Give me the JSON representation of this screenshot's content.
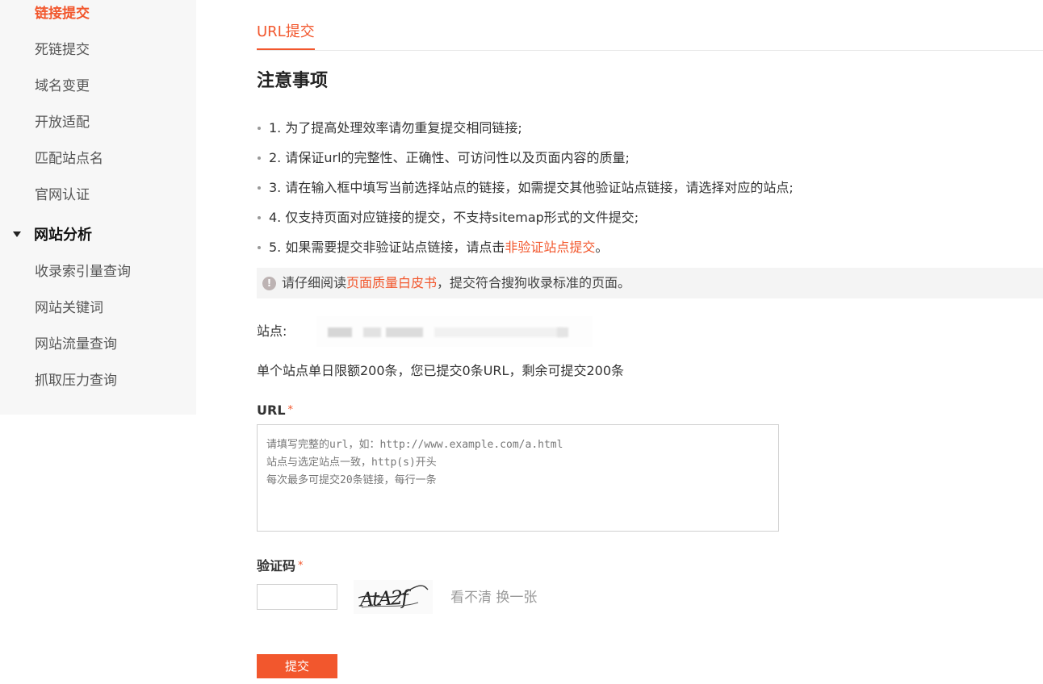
{
  "sidebar": {
    "items_top": [
      {
        "label": "链接提交",
        "active": true
      },
      {
        "label": "死链提交",
        "active": false
      },
      {
        "label": "域名变更",
        "active": false
      },
      {
        "label": "开放适配",
        "active": false
      },
      {
        "label": "匹配站点名",
        "active": false
      },
      {
        "label": "官网认证",
        "active": false
      }
    ],
    "group_label": "网站分析",
    "group_items": [
      {
        "label": "收录索引量查询"
      },
      {
        "label": "网站关键词"
      },
      {
        "label": "网站流量查询"
      },
      {
        "label": "抓取压力查询"
      }
    ]
  },
  "tabs": [
    {
      "label": "URL提交",
      "active": true
    }
  ],
  "notice": {
    "title": "注意事项",
    "items": [
      "1. 为了提高处理效率请勿重复提交相同链接;",
      "2. 请保证url的完整性、正确性、可访问性以及页面内容的质量;",
      "3. 请在输入框中填写当前选择站点的链接，如需提交其他验证站点链接，请选择对应的站点;",
      "4. 仅支持页面对应链接的提交，不支持sitemap形式的文件提交;"
    ],
    "item5_prefix": "5. 如果需要提交非验证站点链接，请点击",
    "item5_link": "非验证站点提交",
    "item5_suffix": "。"
  },
  "tip": {
    "prefix": "请仔细阅读",
    "link": "页面质量白皮书",
    "suffix": "，提交符合搜狗收录标准的页面。"
  },
  "site": {
    "label": "站点:"
  },
  "quota_text": "单个站点单日限额200条，您已提交0条URL，剩余可提交200条",
  "url_field": {
    "label": "URL",
    "required_mark": "*",
    "placeholder": "请填写完整的url，如：http://www.example.com/a.html\n站点与选定站点一致，http(s)开头\n每次最多可提交20条链接，每行一条",
    "value": ""
  },
  "captcha": {
    "label": "验证码",
    "required_mark": "*",
    "value": "",
    "image_text": "AtA2f",
    "refresh_label": "看不清 换一张"
  },
  "submit_label": "提交",
  "colors": {
    "accent": "#f2572d",
    "sidebar_bg": "#f7f7f7",
    "tip_bg": "#f4f4f4"
  }
}
